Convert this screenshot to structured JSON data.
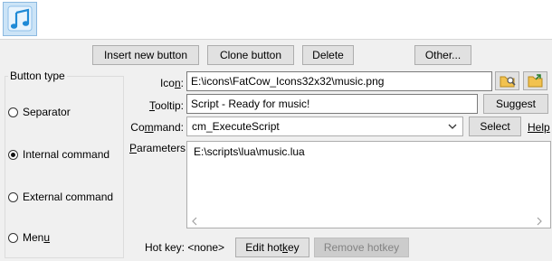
{
  "toolbar": {
    "preview_icon": "music-notes-icon"
  },
  "actions": {
    "insert_label": "Insert new button",
    "clone_label": "Clone button",
    "delete_label": "Delete",
    "other_label": "Other..."
  },
  "button_type": {
    "title": "Button type",
    "options": [
      {
        "pre": "Separator",
        "u": "",
        "post": "",
        "checked": false
      },
      {
        "pre": "Internal command",
        "u": "",
        "post": "",
        "checked": true
      },
      {
        "pre": "External command",
        "u": "",
        "post": "",
        "checked": false
      },
      {
        "pre": "Men",
        "u": "u",
        "post": "",
        "checked": false
      }
    ]
  },
  "form": {
    "icon_label_pre": "Ico",
    "icon_label_u": "n",
    "icon_label_post": ":",
    "icon_value": "E:\\icons\\FatCow_Icons32x32\\music.png",
    "tooltip_label_u": "T",
    "tooltip_label_post": "ooltip:",
    "tooltip_value": "Script - Ready for music!",
    "suggest_label": "Suggest",
    "command_label_pre": "Co",
    "command_label_u": "m",
    "command_label_post": "mand:",
    "command_value": "cm_ExecuteScript",
    "select_label": "Select",
    "help_label": "Help",
    "parameters_label_u": "P",
    "parameters_label_post": "arameters:",
    "parameters_value": "E:\\scripts\\lua\\music.lua"
  },
  "hotkey": {
    "label": "Hot key: <none>",
    "edit_pre": "Edit hot",
    "edit_u": "k",
    "edit_post": "ey",
    "remove_label": "Remove hotkey"
  },
  "colors": {
    "window_bg": "#f0f0f0",
    "tile_selected": "#cce4f7",
    "note_blue": "#1f8ad6"
  }
}
